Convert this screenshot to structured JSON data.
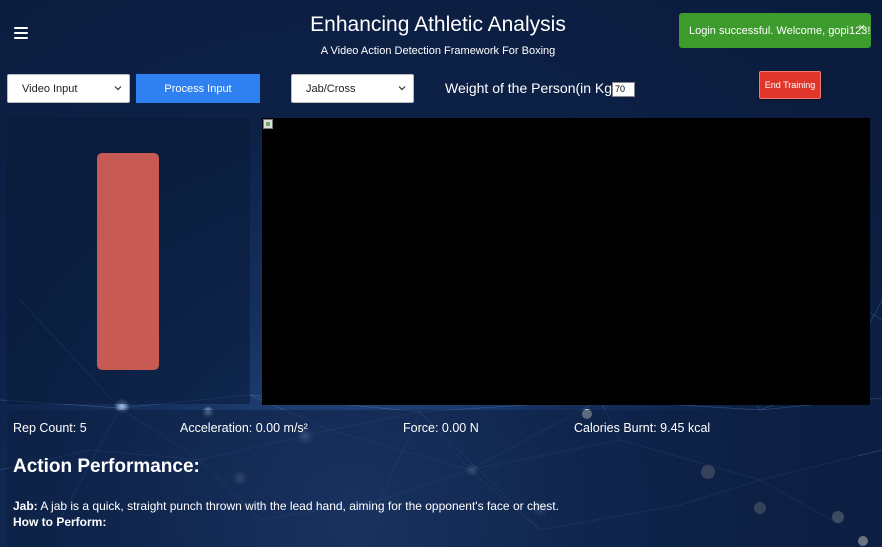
{
  "header": {
    "title": "Enhancing Athletic Analysis",
    "subtitle": "A Video Action Detection Framework For Boxing",
    "menu_icon": "hamburger-menu-icon"
  },
  "toast": {
    "message": "Login successful. Welcome, gopi123!",
    "close_label": "×",
    "color": "#3d9a2c"
  },
  "controls": {
    "input_select": {
      "selected": "Video Input"
    },
    "process_button": {
      "label": "Process Input",
      "color": "#2f80f0"
    },
    "action_select": {
      "selected": "Jab/Cross"
    },
    "weight_label": "Weight of the Person(in Kgs):",
    "weight_value": "70",
    "end_button": {
      "label": "End Training",
      "color": "#e0352a"
    }
  },
  "progress_bar": {
    "color": "#c75a52",
    "level": 1.0
  },
  "stats": {
    "rep_count": "Rep Count: 5",
    "acceleration": "Acceleration: 0.00 m/s²",
    "force": "Force: 0.00 N",
    "calories": "Calories Burnt: 9.45 kcal"
  },
  "performance": {
    "title": "Action Performance:",
    "jab_term": "Jab:",
    "jab_description": " A jab is a quick, straight punch thrown with the lead hand, aiming for the opponent's face or chest.",
    "how_to": "How to Perform:"
  }
}
